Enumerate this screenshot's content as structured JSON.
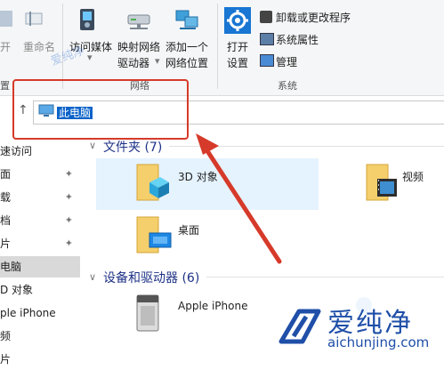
{
  "ribbon": {
    "items": [
      {
        "label": "开",
        "dim": true
      },
      {
        "label": "重命名",
        "dim": true
      },
      {
        "label": "访问媒体"
      },
      {
        "label": "映射网络"
      },
      {
        "label": "驱动器"
      },
      {
        "label": "添加一个"
      },
      {
        "label": "网络位置"
      },
      {
        "label": "打开"
      },
      {
        "label": "设置"
      },
      {
        "label": "卸载或更改程序"
      },
      {
        "label": "系统属性"
      },
      {
        "label": "管理"
      }
    ],
    "groups": {
      "left_partial": "置",
      "network": "网络",
      "system": "系统"
    }
  },
  "address": {
    "back_arrow": "↑",
    "path": "此电脑"
  },
  "nav": {
    "items": [
      {
        "label": "速访问",
        "pinned": false
      },
      {
        "label": "面",
        "pinned": true
      },
      {
        "label": "载",
        "pinned": true
      },
      {
        "label": "档",
        "pinned": true
      },
      {
        "label": "片",
        "pinned": true
      },
      {
        "label": "电脑",
        "pinned": false,
        "active": true
      },
      {
        "label": "D 对象",
        "pinned": false
      },
      {
        "label": "ple iPhone",
        "pinned": false
      },
      {
        "label": "频",
        "pinned": false
      },
      {
        "label": "片",
        "pinned": false
      }
    ]
  },
  "folders_section": {
    "title": "文件夹 (7)",
    "items": [
      "3D 对象",
      "视频",
      "桌面"
    ]
  },
  "devices_section": {
    "title": "设备和驱动器 (6)",
    "items": [
      "Apple iPhone"
    ]
  },
  "watermark": {
    "name": "爱纯净",
    "url": "aichunjing.com"
  },
  "colors": {
    "accent": "#0b63c9",
    "highlight_box": "#d63a2a",
    "selected_tile": "#e5f3ff",
    "section_title": "#1e3287"
  }
}
